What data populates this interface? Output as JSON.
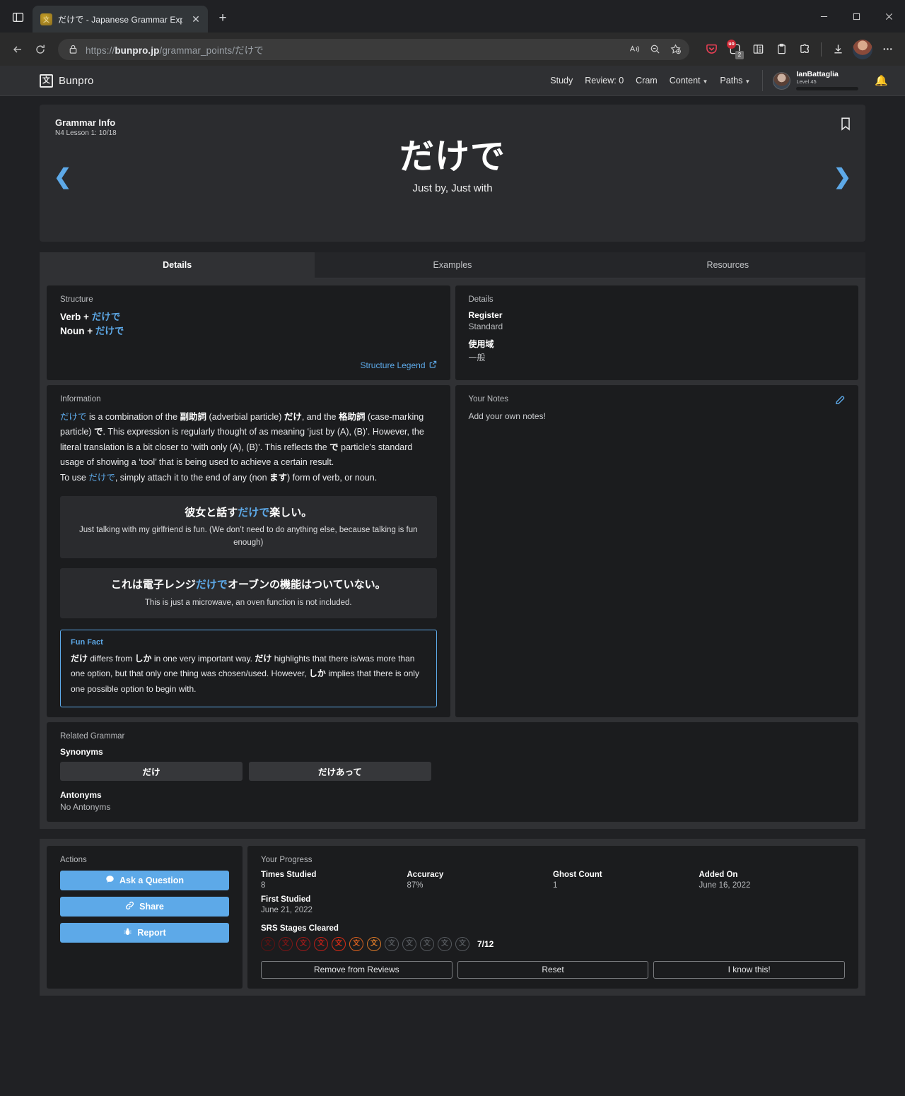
{
  "browser": {
    "tab": {
      "title": "だけで - Japanese Grammar Expla",
      "favicon": "文",
      "close_label": "✕"
    },
    "newtab_label": "+",
    "tab_list_icon": "tab-list-icon",
    "url_prefix": "https://",
    "url_domain": "bunpro.jp",
    "url_path": "/grammar_points/だけで",
    "extensions": {
      "uo_badge": "uo",
      "uo_count": "2"
    }
  },
  "site": {
    "brand": {
      "logo_glyph": "文",
      "name": "Bunpro"
    },
    "nav": [
      {
        "label": "Study",
        "has_caret": false
      },
      {
        "label": "Review: 0",
        "has_caret": false
      },
      {
        "label": "Cram",
        "has_caret": false
      },
      {
        "label": "Content",
        "has_caret": true
      },
      {
        "label": "Paths",
        "has_caret": true
      }
    ],
    "user": {
      "name": "IanBattaglia",
      "level": "Level 45"
    }
  },
  "grammar_info": {
    "title": "Grammar Info",
    "subtitle": "N4 Lesson 1: 10/18",
    "term": "だけで",
    "meaning": "Just by, Just with",
    "prev_arrow": "❮",
    "next_arrow": "❯"
  },
  "tabs": [
    {
      "label": "Details",
      "active": true
    },
    {
      "label": "Examples",
      "active": false
    },
    {
      "label": "Resources",
      "active": false
    }
  ],
  "structure": {
    "label": "Structure",
    "lines": [
      {
        "pos": "Verb",
        "plus": "+",
        "jp": "だけで"
      },
      {
        "pos": "Noun",
        "plus": "+",
        "jp": "だけで"
      }
    ],
    "legend_link": "Structure Legend"
  },
  "details": {
    "label": "Details",
    "entries": [
      {
        "key": "Register",
        "value": "Standard"
      },
      {
        "key": "使用域",
        "value": "一般"
      }
    ]
  },
  "information": {
    "label": "Information",
    "paragraph1_parts": {
      "a": "だけで",
      "b": " is a combination of the ",
      "c": "副助詞",
      "d": " (adverbial particle) ",
      "e": "だけ",
      "f": ", and the ",
      "g": "格助詞",
      "h": " (case-marking particle) ",
      "i": "で",
      "j": ". This expression is regularly thought of as meaning ‘just by (A), (B)’. However, the literal translation is a bit closer to ‘with only (A), (B)’. This reflects the ",
      "k": "で",
      "l": " particle’s standard usage of showing a ‘tool’ that is being used to achieve a certain result."
    },
    "paragraph2_parts": {
      "a": "To use ",
      "b": "だけで",
      "c": ", simply attach it to the end of any (non ",
      "d": "ます",
      "e": ") form of verb, or noun."
    },
    "examples": [
      {
        "jp_before": "彼女と話す",
        "jp_highlight": "だけで",
        "jp_after": "楽しい。",
        "en": "Just talking with my girlfriend is fun. (We don’t need to do anything else, because talking is fun enough)"
      },
      {
        "jp_before": "これは電子レンジ",
        "jp_highlight": "だけで",
        "jp_after": "オーブンの機能はついていない。",
        "en": "This is just a microwave, an oven function is not included."
      }
    ],
    "fun_fact": {
      "title": "Fun Fact",
      "parts": {
        "a": "だけ",
        "b": " differs from ",
        "c": "しか",
        "d": " in one very important way. ",
        "e": "だけ",
        "f": " highlights that there is/was more than one option, but that only one thing was chosen/used. However, ",
        "g": "しか",
        "h": " implies that there is only one possible option to begin with."
      }
    }
  },
  "notes": {
    "label": "Your Notes",
    "placeholder": "Add your own notes!",
    "edit_icon": "pencil-icon"
  },
  "related": {
    "label": "Related Grammar",
    "synonyms_label": "Synonyms",
    "synonyms": [
      "だけ",
      "だけあって"
    ],
    "antonyms_label": "Antonyms",
    "antonyms_value": "No Antonyms"
  },
  "actions": {
    "label": "Actions",
    "buttons": [
      {
        "label": "Ask a Question",
        "icon": "chat-icon"
      },
      {
        "label": "Share",
        "icon": "link-icon"
      },
      {
        "label": "Report",
        "icon": "bug-icon"
      }
    ]
  },
  "progress": {
    "label": "Your Progress",
    "stats": [
      {
        "key": "Times Studied",
        "value": "8"
      },
      {
        "key": "Accuracy",
        "value": "87%"
      },
      {
        "key": "Ghost Count",
        "value": "1"
      },
      {
        "key": "Added On",
        "value": "June 16, 2022"
      },
      {
        "key": "First Studied",
        "value": "June 21, 2022"
      }
    ],
    "srs_label": "SRS Stages Cleared",
    "srs_count": "7/12",
    "srs_total": 12,
    "srs_cleared": 7,
    "srs_colors": [
      "#5c1313",
      "#7a1616",
      "#9b1a1a",
      "#bb1f18",
      "#d62b15",
      "#d9601f",
      "#d87828"
    ],
    "srs_empty_color": "#55595e",
    "srs_glyph": "文",
    "buttons": [
      "Remove from Reviews",
      "Reset",
      "I know this!"
    ]
  },
  "colors": {
    "accent": "#5da9e8",
    "page_bg": "#202124",
    "card_bg": "#1b1c1e",
    "panel_bg": "#303134"
  }
}
